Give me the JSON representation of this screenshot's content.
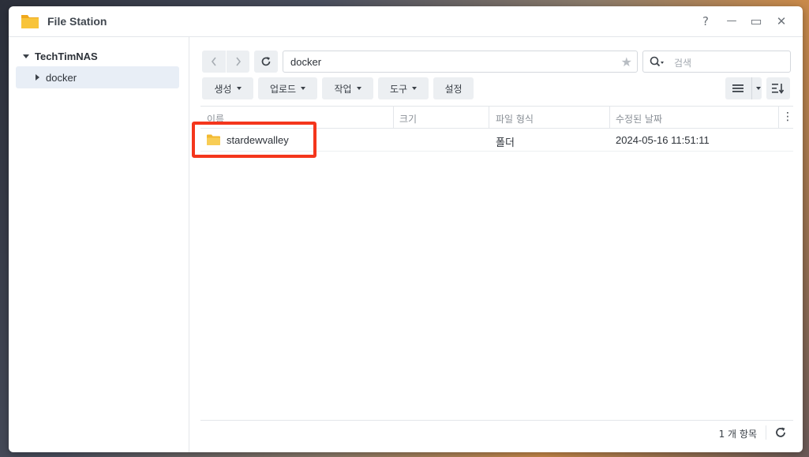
{
  "window": {
    "title": "File Station",
    "controls": {
      "help": "?",
      "minimize": "—",
      "maximize": "▭",
      "close": "✕"
    }
  },
  "sidebar": {
    "root_label": "TechTimNAS",
    "items": [
      {
        "label": "docker"
      }
    ]
  },
  "toolbar": {
    "path": "docker",
    "search_placeholder": "검색",
    "buttons": {
      "create": "생성",
      "upload": "업로드",
      "action": "작업",
      "tools": "도구",
      "settings": "설정"
    }
  },
  "table": {
    "columns": [
      "이름",
      "크기",
      "파일 형식",
      "수정된 날짜"
    ],
    "rows": [
      {
        "name": "stardewvalley",
        "size": "",
        "type": "폴더",
        "modified": "2024-05-16 11:51:11"
      }
    ]
  },
  "footer": {
    "item_count": "1 개 항목"
  },
  "colors": {
    "highlight": "#f4361c",
    "folder": "#f5c542",
    "selected_bg": "#e8eef6"
  },
  "icons": [
    "folder-icon",
    "back-icon",
    "forward-icon",
    "refresh-icon",
    "star-icon",
    "search-icon",
    "list-view-icon",
    "sort-icon",
    "more-icon"
  ]
}
